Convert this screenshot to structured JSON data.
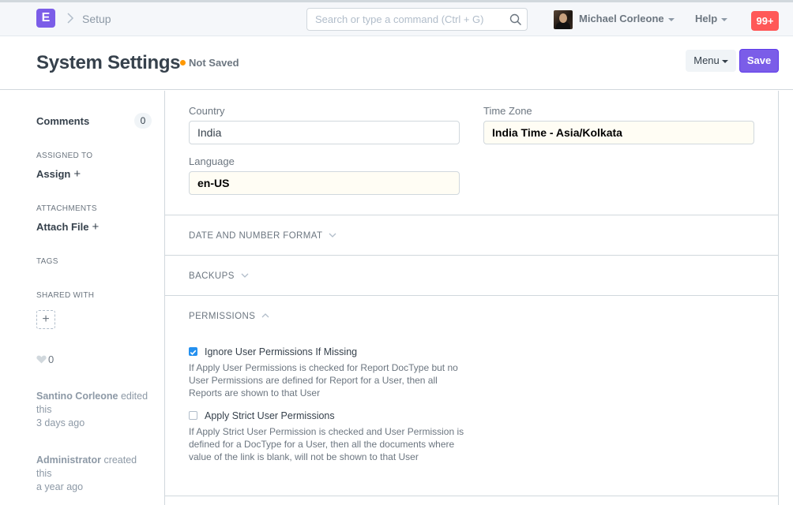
{
  "navbar": {
    "logo_letter": "E",
    "breadcrumb": "Setup",
    "search_placeholder": "Search or type a command (Ctrl + G)",
    "user_name": "Michael Corleone",
    "help_label": "Help",
    "notification_count": "99+"
  },
  "page": {
    "title": "System Settings",
    "status": "Not Saved",
    "menu_label": "Menu",
    "save_label": "Save"
  },
  "sidebar": {
    "comments_label": "Comments",
    "comments_count": "0",
    "assigned_to_label": "ASSIGNED TO",
    "assign_label": "Assign",
    "attachments_label": "ATTACHMENTS",
    "attach_label": "Attach File",
    "tags_label": "TAGS",
    "shared_with_label": "SHARED WITH",
    "likes_count": "0",
    "activity": [
      {
        "user": "Santino Corleone",
        "action": "edited this",
        "time": "3 days ago"
      },
      {
        "user": "Administrator",
        "action": "created this",
        "time": "a year ago"
      }
    ]
  },
  "form": {
    "country_label": "Country",
    "country_value": "India",
    "timezone_label": "Time Zone",
    "timezone_value": "India Time - Asia/Kolkata",
    "language_label": "Language",
    "language_value": "en-US",
    "sections": {
      "date_number": "DATE AND NUMBER FORMAT",
      "backups": "BACKUPS",
      "permissions": "PERMISSIONS"
    },
    "permissions": [
      {
        "label": "Ignore User Permissions If Missing",
        "checked": true,
        "description": "If Apply User Permissions is checked for Report DocType but no User Permissions are defined for Report for a User, then all Reports are shown to that User"
      },
      {
        "label": "Apply Strict User Permissions",
        "checked": false,
        "description": "If Apply Strict User Permission is checked and User Permission is defined for a DocType for a User, then all the documents where value of the link is blank, will not be shown to that User"
      }
    ]
  },
  "colors": {
    "brand": "#7b5de8",
    "status_dot": "#ff9800",
    "notification": "#ff5858",
    "checkbox": "#2490ef"
  }
}
